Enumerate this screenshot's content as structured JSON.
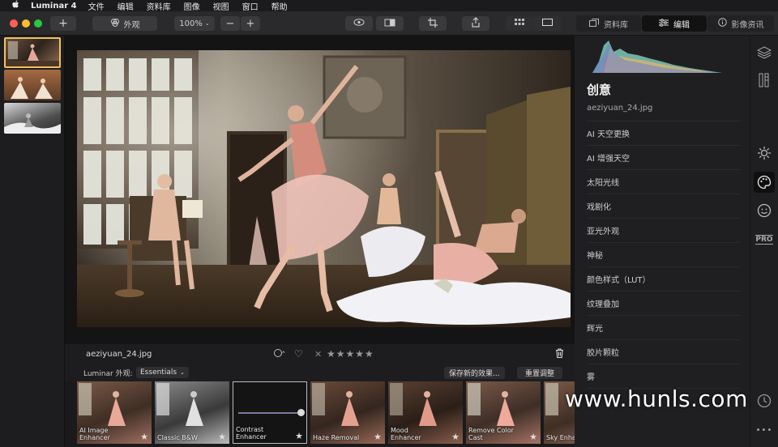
{
  "menubar": {
    "apple": "",
    "app_name": "Luminar 4",
    "items": [
      "文件",
      "编辑",
      "资料库",
      "图像",
      "视图",
      "窗口",
      "帮助"
    ]
  },
  "toolbar": {
    "add": "+",
    "appearance": "外观",
    "zoom": "100%",
    "zoom_out": "−",
    "zoom_in": "+",
    "library_tab": "资料库",
    "edit_tab": "编辑",
    "info_tab": "影像资讯"
  },
  "image": {
    "filename": "aeziyuan_24.jpg"
  },
  "infobar": {
    "filename": "aeziyuan_24.jpg",
    "stars": "★★★★★",
    "reject": "✕",
    "heart": "♡"
  },
  "looksbar": {
    "label": "Luminar 外观:",
    "category": "Essentials",
    "save_button": "保存新的效果...",
    "reset_button": "重置调整"
  },
  "looks": [
    {
      "name": "AI Image\nEnhancer"
    },
    {
      "name": "Classic B&W"
    },
    {
      "name": "Contrast\nEnhancer"
    },
    {
      "name": "Haze Removal"
    },
    {
      "name": "Mood\nEnhancer"
    },
    {
      "name": "Remove Color\nCast"
    },
    {
      "name": "Sky Enha"
    }
  ],
  "panel": {
    "title": "创意",
    "filename": "aeziyuan_24.jpg",
    "tools": [
      "AI 天空更换",
      "AI 增强天空",
      "太阳光线",
      "戏剧化",
      "亚光外观",
      "神秘",
      "颜色样式（LUT）",
      "纹理叠加",
      "辉光",
      "胶片颗粒",
      "雾"
    ]
  },
  "sidebar": {
    "pro": "PRO",
    "more": "•••"
  },
  "watermark": "www.hunls.com",
  "colors": {
    "accent": "#f0c060",
    "close": "#fe5f57",
    "minimize": "#febc2e",
    "zoom": "#28c840"
  }
}
